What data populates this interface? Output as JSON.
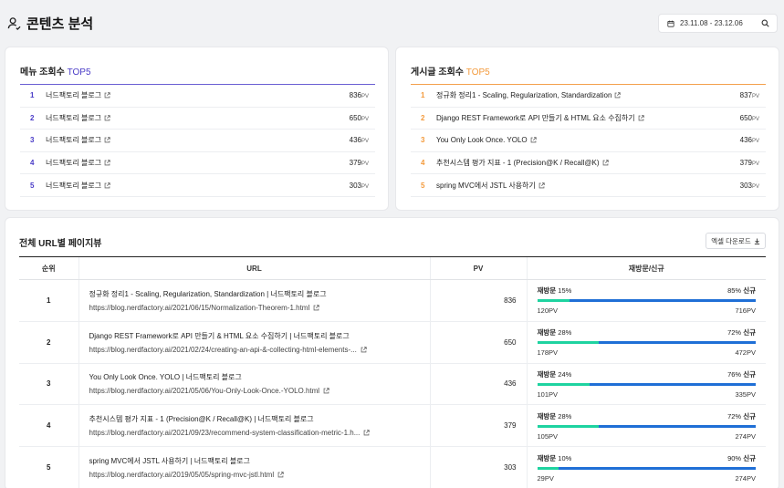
{
  "header": {
    "title": "콘텐츠 분석",
    "date_range": "23.11.08  -  23.12.06"
  },
  "menu_top5": {
    "title": "메뉴 조회수",
    "accent": "TOP5",
    "unit": "PV",
    "items": [
      {
        "rank": "1",
        "name": "너드팩토리 블로그",
        "pv": "836"
      },
      {
        "rank": "2",
        "name": "너드팩토리 블로그",
        "pv": "650"
      },
      {
        "rank": "3",
        "name": "너드팩토리 블로그",
        "pv": "436"
      },
      {
        "rank": "4",
        "name": "너드팩토리 블로그",
        "pv": "379"
      },
      {
        "rank": "5",
        "name": "너드팩토리 블로그",
        "pv": "303"
      }
    ]
  },
  "post_top5": {
    "title": "게시글 조회수",
    "accent": "TOP5",
    "unit": "PV",
    "items": [
      {
        "rank": "1",
        "name": "정규화 정리1 - Scaling, Regularization, Standardization",
        "pv": "837"
      },
      {
        "rank": "2",
        "name": "Django REST Framework로 API 만들기 & HTML 요소 수집하기",
        "pv": "650"
      },
      {
        "rank": "3",
        "name": "You Only Look Once. YOLO",
        "pv": "436"
      },
      {
        "rank": "4",
        "name": "추천시스템 평가 지표 - 1 (Precision@K / Recall@K)",
        "pv": "379"
      },
      {
        "rank": "5",
        "name": "spring MVC에서 JSTL 사용하기",
        "pv": "303"
      }
    ]
  },
  "url_table": {
    "title": "전체 URL별 페이지뷰",
    "excel_label": "엑셀 다운로드",
    "columns": [
      "순위",
      "URL",
      "PV",
      "재방문/신규"
    ],
    "revisit_label": "재방문",
    "new_label": "신규",
    "rows": [
      {
        "rank": "1",
        "title": "정규화 정리1 - Scaling, Regularization, Standardization | 너드팩토리 블로그",
        "url": "https://blog.nerdfactory.ai/2021/06/15/Normalization-Theorem-1.html",
        "pv": "836",
        "revisit_pct": "15%",
        "new_pct": "85%",
        "revisit_pv": "120PV",
        "new_pv": "716PV",
        "revisit_ratio": 0.15
      },
      {
        "rank": "2",
        "title": "Django REST Framework로 API 만들기 & HTML 요소 수집하기 | 너드팩토리 블로그",
        "url": "https://blog.nerdfactory.ai/2021/02/24/creating-an-api-&-collecting-html-elements-...",
        "pv": "650",
        "revisit_pct": "28%",
        "new_pct": "72%",
        "revisit_pv": "178PV",
        "new_pv": "472PV",
        "revisit_ratio": 0.28
      },
      {
        "rank": "3",
        "title": "You Only Look Once. YOLO | 너드팩토리 블로그",
        "url": "https://blog.nerdfactory.ai/2021/05/06/You-Only-Look-Once.-YOLO.html",
        "pv": "436",
        "revisit_pct": "24%",
        "new_pct": "76%",
        "revisit_pv": "101PV",
        "new_pv": "335PV",
        "revisit_ratio": 0.24
      },
      {
        "rank": "4",
        "title": "추천시스템 평가 지표 - 1 (Precision@K / Recall@K) | 너드팩토리 블로그",
        "url": "https://blog.nerdfactory.ai/2021/09/23/recommend-system-classification-metric-1.h...",
        "pv": "379",
        "revisit_pct": "28%",
        "new_pct": "72%",
        "revisit_pv": "105PV",
        "new_pv": "274PV",
        "revisit_ratio": 0.28
      },
      {
        "rank": "5",
        "title": "spring MVC에서 JSTL 사용하기 | 너드팩토리 블로그",
        "url": "https://blog.nerdfactory.ai/2019/05/05/spring-mvc-jstl.html",
        "pv": "303",
        "revisit_pct": "10%",
        "new_pct": "90%",
        "revisit_pv": "29PV",
        "new_pv": "274PV",
        "revisit_ratio": 0.1
      }
    ]
  },
  "colors": {
    "menu_accent": "#4a3cc7",
    "post_accent": "#f39a3c",
    "revisit_bar": "#1ed3a0",
    "new_bar": "#1f6fd6"
  },
  "icons": {
    "title_icon": "user-icon",
    "date_icon": "calendar-icon",
    "search_icon": "search-icon",
    "link_icon": "external-link-icon",
    "download_icon": "download-icon"
  }
}
